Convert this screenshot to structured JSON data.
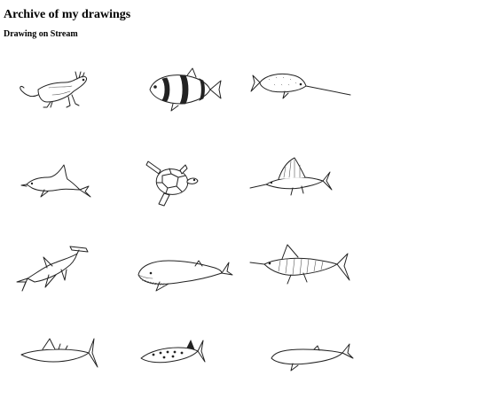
{
  "page": {
    "title": "Archive of my drawings",
    "section_heading": "Drawing on Stream"
  },
  "drawings": [
    {
      "subject": "iguana-lizard"
    },
    {
      "subject": "clownfish"
    },
    {
      "subject": "narwhal"
    },
    {
      "subject": "dolphin"
    },
    {
      "subject": "sea-turtle"
    },
    {
      "subject": "sailfish"
    },
    {
      "subject": "hammerhead-shark"
    },
    {
      "subject": "humpback-whale"
    },
    {
      "subject": "striped-marlin"
    },
    {
      "subject": "swordfish"
    },
    {
      "subject": "spotted-fish"
    },
    {
      "subject": "beluga"
    }
  ]
}
